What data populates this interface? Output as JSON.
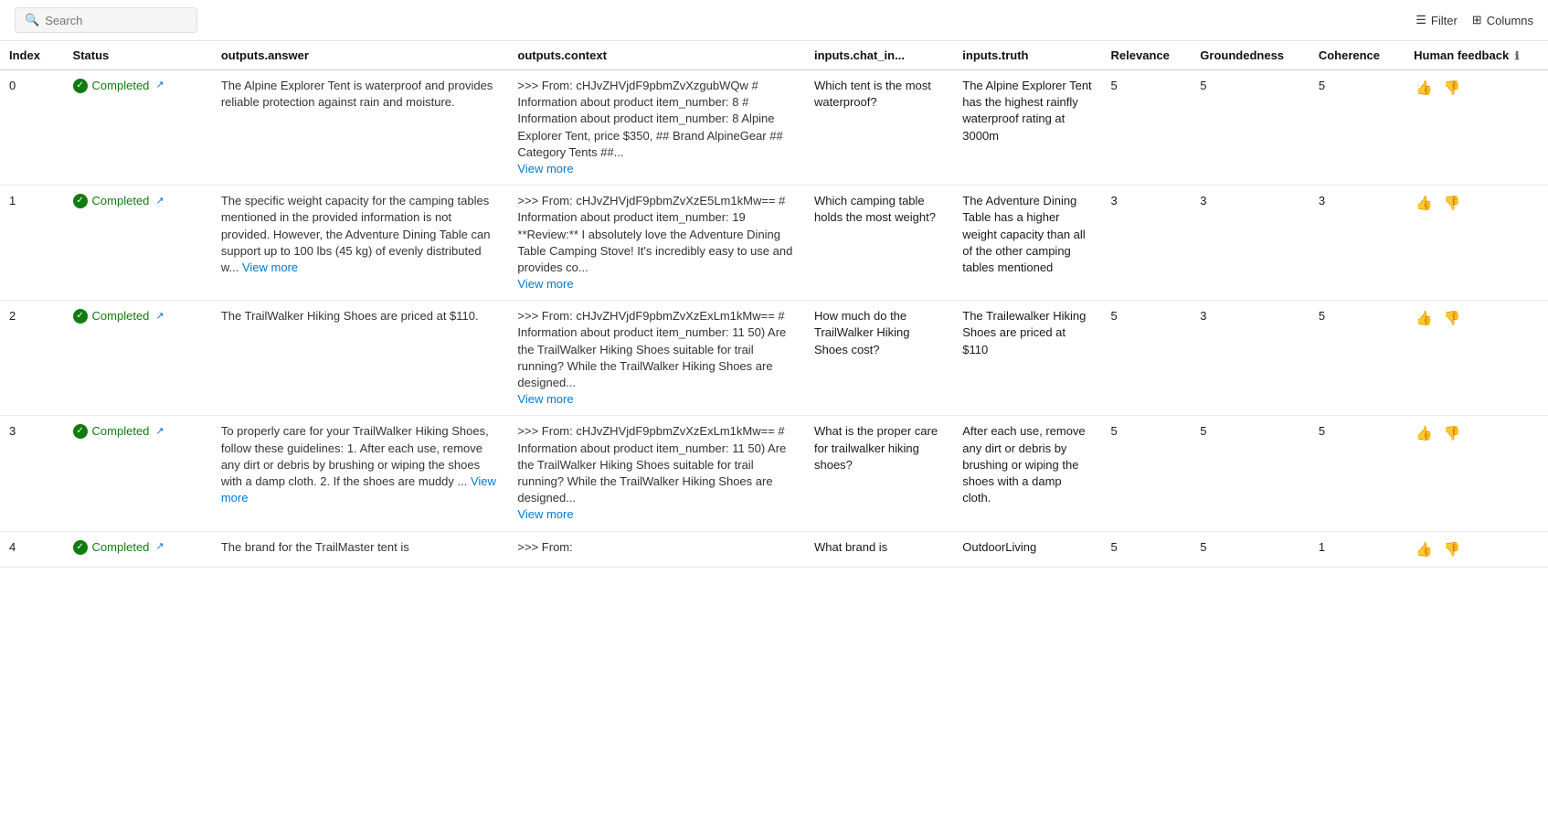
{
  "topBar": {
    "search": {
      "placeholder": "Search",
      "value": ""
    },
    "filterLabel": "Filter",
    "columnsLabel": "Columns"
  },
  "table": {
    "columns": [
      {
        "key": "index",
        "label": "Index"
      },
      {
        "key": "status",
        "label": "Status"
      },
      {
        "key": "answer",
        "label": "outputs.answer"
      },
      {
        "key": "context",
        "label": "outputs.context"
      },
      {
        "key": "chat_in",
        "label": "inputs.chat_in..."
      },
      {
        "key": "truth",
        "label": "inputs.truth"
      },
      {
        "key": "relevance",
        "label": "Relevance"
      },
      {
        "key": "groundedness",
        "label": "Groundedness"
      },
      {
        "key": "coherence",
        "label": "Coherence"
      },
      {
        "key": "feedback",
        "label": "Human feedback"
      }
    ],
    "rows": [
      {
        "index": "0",
        "status": "Completed",
        "answer": "The Alpine Explorer Tent is waterproof and provides reliable protection against rain and moisture.",
        "context": ">>> From: cHJvZHVjdF9pbmZvXzgubWQw # Information about product item_number: 8 # Information about product item_number: 8 Alpine Explorer Tent, price $350, ## Brand AlpineGear ## Category Tents ##...",
        "context_has_more": true,
        "chat_in": "Which tent is the most waterproof?",
        "truth": "The Alpine Explorer Tent has the highest rainfly waterproof rating at 3000m",
        "relevance": "5",
        "groundedness": "5",
        "coherence": "5"
      },
      {
        "index": "1",
        "status": "Completed",
        "answer": "The specific weight capacity for the camping tables mentioned in the provided information is not provided. However, the Adventure Dining Table can support up to 100 lbs (45 kg) of evenly distributed w...",
        "answer_has_more": true,
        "context": ">>> From: cHJvZHVjdF9pbmZvXzE5Lm1kMw== # Information about product item_number: 19 **Review:** I absolutely love the Adventure Dining Table Camping Stove! It's incredibly easy to use and provides co...",
        "context_has_more": true,
        "chat_in": "Which camping table holds the most weight?",
        "truth": "The Adventure Dining Table has a higher weight capacity than all of the other camping tables mentioned",
        "relevance": "3",
        "groundedness": "3",
        "coherence": "3"
      },
      {
        "index": "2",
        "status": "Completed",
        "answer": "The TrailWalker Hiking Shoes are priced at $110.",
        "context": ">>> From: cHJvZHVjdF9pbmZvXzExLm1kMw== # Information about product item_number: 11 50) Are the TrailWalker Hiking Shoes suitable for trail running? While the TrailWalker Hiking Shoes are designed...",
        "context_has_more": true,
        "chat_in": "How much do the TrailWalker Hiking Shoes cost?",
        "truth": "The Trailewalker Hiking Shoes are priced at $110",
        "relevance": "5",
        "groundedness": "3",
        "coherence": "5"
      },
      {
        "index": "3",
        "status": "Completed",
        "answer": "To properly care for your TrailWalker Hiking Shoes, follow these guidelines: 1. After each use, remove any dirt or debris by brushing or wiping the shoes with a damp cloth. 2. If the shoes are muddy ...",
        "answer_has_more": true,
        "context": ">>> From: cHJvZHVjdF9pbmZvXzExLm1kMw== # Information about product item_number: 11 50) Are the TrailWalker Hiking Shoes suitable for trail running? While the TrailWalker Hiking Shoes are designed...",
        "context_has_more": true,
        "chat_in": "What is the proper care for trailwalker hiking shoes?",
        "truth": "After each use, remove any dirt or debris by brushing or wiping the shoes with a damp cloth.",
        "relevance": "5",
        "groundedness": "5",
        "coherence": "5"
      },
      {
        "index": "4",
        "status": "Completed",
        "answer": "The brand for the TrailMaster tent is",
        "context": ">>> From:",
        "chat_in": "What brand is",
        "truth": "OutdoorLiving",
        "relevance": "5",
        "groundedness": "5",
        "coherence": "1"
      }
    ]
  }
}
